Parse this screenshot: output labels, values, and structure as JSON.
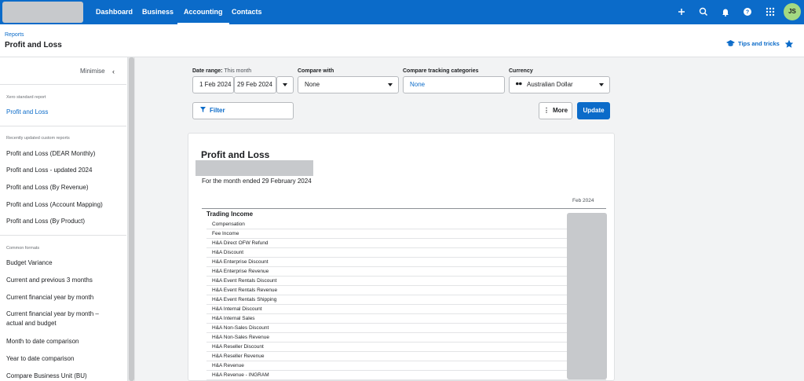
{
  "nav": {
    "items": [
      "Dashboard",
      "Business",
      "Accounting",
      "Contacts"
    ],
    "active": "Accounting",
    "avatar_initials": "JS",
    "icons": [
      "plus-icon",
      "search-icon",
      "bell-icon",
      "help-icon",
      "apps-grid-icon"
    ]
  },
  "header": {
    "breadcrumb": "Reports",
    "title": "Profit and Loss",
    "tips": "Tips and tricks"
  },
  "sidebar": {
    "minimise": "Minimise",
    "standard_section": "Xero standard report",
    "standard_items": [
      "Profit and Loss"
    ],
    "custom_section": "Recently updated custom reports",
    "custom_items": [
      "Profit and Loss (DEAR Monthly)",
      "Profit and Loss - updated 2024",
      "Profit and Loss (By Revenue)",
      "Profit and Loss (Account Mapping)",
      "Profit and Loss (By Product)"
    ],
    "formats_section": "Common formats",
    "format_items": [
      "Budget Variance",
      "Current and previous 3 months",
      "Current financial year by month",
      "Current financial year by month – actual and budget",
      "Month to date comparison",
      "Year to date comparison",
      "Compare Business Unit (BU)"
    ]
  },
  "controls": {
    "date_range_label": "Date range:",
    "date_range_value": "This month",
    "date_from": "1 Feb 2024",
    "date_to": "29 Feb 2024",
    "compare_label": "Compare with",
    "compare_value": "None",
    "tracking_label": "Compare tracking categories",
    "tracking_value": "None",
    "currency_label": "Currency",
    "currency_value": "Australian Dollar",
    "filter": "Filter",
    "more": "More",
    "update": "Update"
  },
  "report": {
    "title": "Profit and Loss",
    "subtitle": "For the month ended 29 February 2024",
    "column": "Feb 2024",
    "section": "Trading Income",
    "rows": [
      "Compensation",
      "Fee Income",
      "H&A Direct OFW Refund",
      "H&A Discount",
      "H&A Enterprise Discount",
      "H&A Enterprise Revenue",
      "H&A Event Rentals Discount",
      "H&A Event Rentals Revenue",
      "H&A Event Rentals Shipping",
      "H&A Internal Discount",
      "H&A Internal Sales",
      "H&A Non-Sales Discount",
      "H&A Non-Sales Revenue",
      "H&A Reseller Discount",
      "H&A Reseller Revenue",
      "H&A Revenue",
      "H&A Revenue - INGRAM"
    ]
  }
}
